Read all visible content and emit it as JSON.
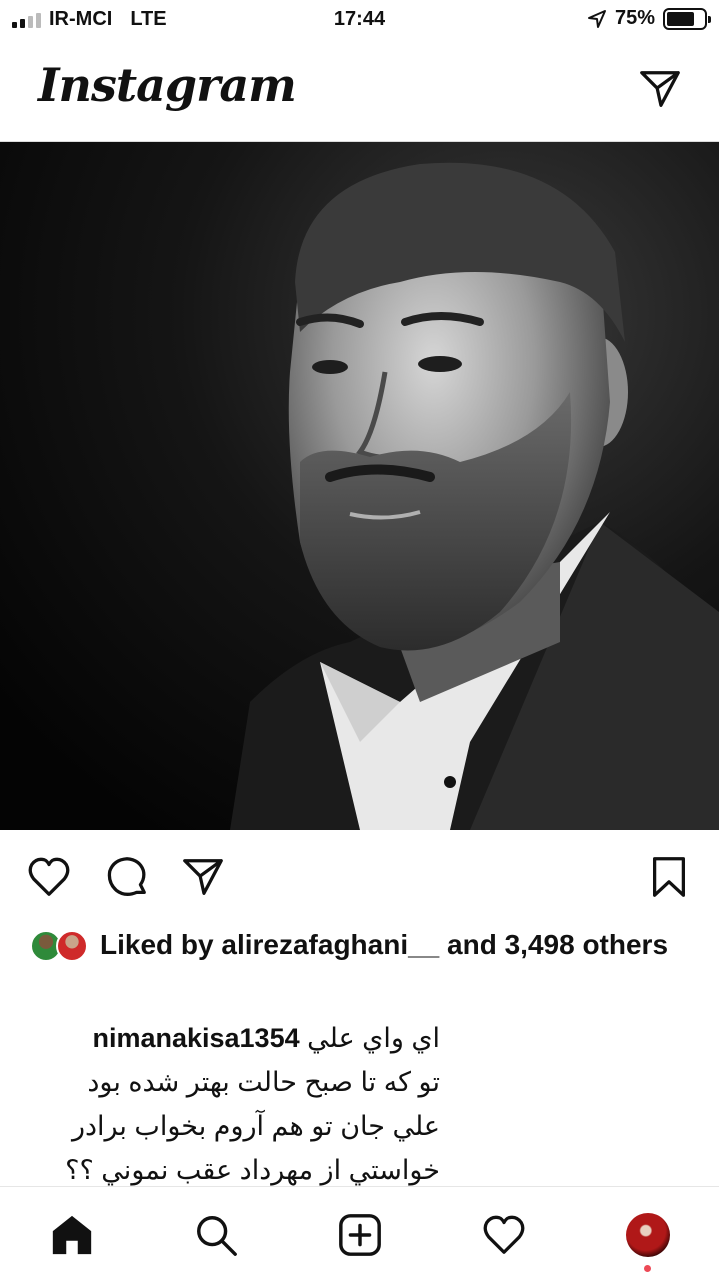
{
  "status_bar": {
    "carrier": "IR-MCI",
    "network": "LTE",
    "time": "17:44",
    "battery": "75%",
    "battery_level": 0.75
  },
  "header": {
    "logo_text": "Instagram",
    "dm_icon": "paper-plane-icon"
  },
  "post": {
    "image_icon": "portrait-photo",
    "actions": [
      "heart-icon",
      "comment-icon",
      "share-icon",
      "bookmark-icon"
    ],
    "likes": {
      "prefix": "Liked by",
      "user": "alirezafaghani__",
      "middle": "and",
      "count": "3,498",
      "suffix": "others"
    },
    "caption": {
      "username": "nimanakisa1354",
      "lines": [
        "اي واي علي",
        "تو كه تا صبح حالت بهتر شده بود",
        "علي جان تو هم آروم بخواب برادر",
        "خواستي از مهرداد عقب نموني ؟؟"
      ]
    }
  },
  "tab_bar": {
    "items": [
      "home-icon",
      "search-icon",
      "new-post-icon",
      "activity-heart-icon",
      "profile-avatar"
    ],
    "accent": "#ed4956"
  }
}
